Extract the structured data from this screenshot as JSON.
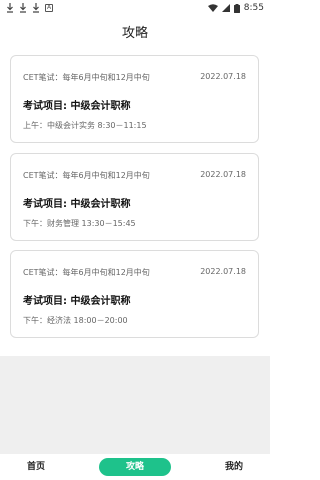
{
  "status_bar": {
    "time": "8:55"
  },
  "header": {
    "title": "攻略"
  },
  "cards": [
    {
      "exam": "CET笔试：每年6月中旬和12月中旬",
      "date": "2022.07.18",
      "title": "考试项目: 中级会计职称",
      "detail": "上午：中级会计实务 8:30－11:15"
    },
    {
      "exam": "CET笔试：每年6月中旬和12月中旬",
      "date": "2022.07.18",
      "title": "考试项目: 中级会计职称",
      "detail": "下午：财务管理 13:30－15:45"
    },
    {
      "exam": "CET笔试：每年6月中旬和12月中旬",
      "date": "2022.07.18",
      "title": "考试项目: 中级会计职称",
      "detail": "下午：经济法 18:00－20:00"
    }
  ],
  "tabbar": {
    "tabs": [
      {
        "label": "首页"
      },
      {
        "label": "攻略"
      },
      {
        "label": "我的"
      }
    ],
    "active_color": "#1ec28b"
  }
}
